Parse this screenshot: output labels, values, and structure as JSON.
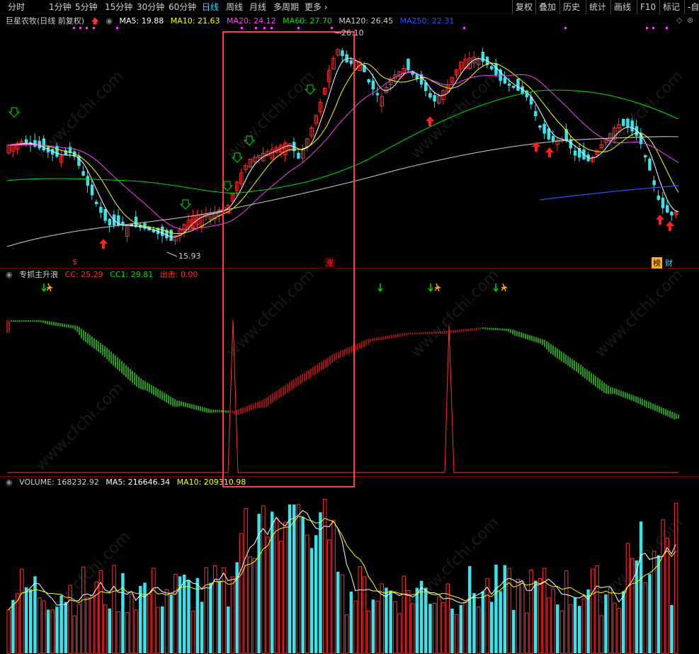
{
  "toolbar": {
    "periods": [
      "分时",
      "1分钟",
      "5分钟",
      "15分钟",
      "30分钟",
      "60分钟",
      "日线",
      "周线",
      "月线",
      "多周期",
      "更多"
    ],
    "active_period": "日线",
    "more_arrow": "›",
    "right_buttons": [
      "复权",
      "叠加",
      "历史",
      "统计",
      "画线",
      "F10",
      "标记",
      "-自"
    ]
  },
  "main_legend": {
    "stock": "巨星农牧(日线 前复权)",
    "ma5": "MA5: 19.88",
    "ma10": "MA10: 21.63",
    "ma20": "MA20: 24.12",
    "ma60": "MA60: 27.70",
    "ma120": "MA120: 26.45",
    "ma250": "MA250: 22.31",
    "colors": {
      "ma5": "#ffffff",
      "ma10": "#ffff00",
      "ma20": "#ff40ff",
      "ma60": "#00e000",
      "ma120": "#d0d0d0",
      "ma250": "#3050ff"
    }
  },
  "main_annotations": {
    "high_price": "26.10",
    "low_price": "15.93",
    "tag_zhang": "涨",
    "tag_bang": "榜",
    "tag_cai": "财",
    "tag_s": "$"
  },
  "indicator_legend": {
    "name": "专抓主升浪",
    "cc": "CC: 25.29",
    "cc1": "CC1: 29.81",
    "chu": "出击: 0.00"
  },
  "volume_legend": {
    "volume": "VOLUME: 168232.92",
    "ma5": "MA5: 216646.34",
    "ma10": "MA10: 209310.98"
  },
  "watermark": "www.cfchi.com",
  "chart_data": {
    "type": "candlestick",
    "price_range": [
      15.0,
      27.0
    ],
    "highlight_box": "red rectangle marking main-rise start",
    "indicator_range": [
      0,
      100
    ],
    "volume_series_colors": {
      "up": "#ff3030",
      "down": "#40e0e8"
    }
  }
}
